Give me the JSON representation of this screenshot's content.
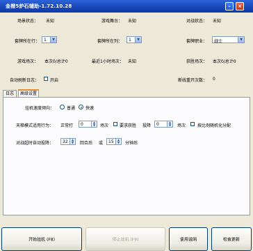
{
  "window": {
    "title": "金橙5炉石辅助-1.72.10.28"
  },
  "status": {
    "scene_label": "场景状态：",
    "scene_value": "未知",
    "arena_label": "游戏舞台：",
    "arena_value": "未知",
    "battle_label": "对战状态：",
    "battle_value": "未知"
  },
  "config": {
    "deck_row_label": "套牌所在行：",
    "deck_row_value": "1",
    "deck_col_label": "套牌所在列：",
    "deck_col_value": "1",
    "deck_class_label": "套牌职业：",
    "deck_class_value": "战士"
  },
  "stats": {
    "games_label": "游戏场次：",
    "games_value": "本次0/总计0",
    "recent_label": "最近1小时场次：",
    "recent_value": "未知",
    "wins_label": "获胜场次：",
    "wins_value": "本次0/总计0"
  },
  "log": {
    "auto_refresh_label": "自动刷新日志：",
    "on_label": "开启",
    "restart_label": "断线重开次数：",
    "restart_value": "0"
  },
  "tabs": [
    {
      "label": "日志"
    },
    {
      "label": "高级设置"
    }
  ],
  "advanced": {
    "speed_label": "挂机速度倾向：",
    "speed_normal": "普通",
    "speed_fast": "快速",
    "ladder_label": "天梯模式适用行为：",
    "ladder_mode": "正常打",
    "ladder_count": "0",
    "ladder_unit": "场次",
    "require_win_label": "要求获胜",
    "surrender_label": "投降",
    "surrender_count": "0",
    "surrender_unit": "场次",
    "random_label": "按比例随机化分配",
    "timeout_label": "对战超时自动投降：",
    "timeout_rounds": "32",
    "rounds_after": "回合后",
    "or_label": "或",
    "timeout_minutes": "15",
    "minutes_after": "分钟后"
  },
  "buttons": {
    "start": "开始挂机 (F8)",
    "stop": "停止挂机 (F9)",
    "help": "使用说明",
    "update": "检查更新"
  }
}
